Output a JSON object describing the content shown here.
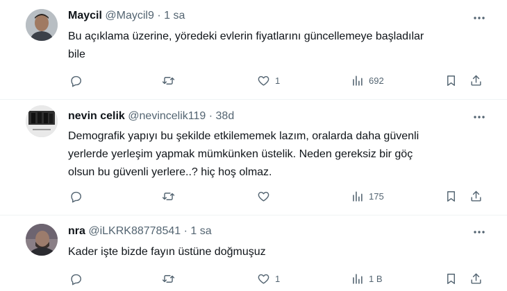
{
  "tweets": [
    {
      "name": "Maycil",
      "handle": "@Maycil9",
      "separator": "·",
      "time": "1 sa",
      "text_lines": [
        "Bu açıklama üzerine, yöredeki evlerin fiyatlarını güncellemeye başladılar",
        "bile"
      ],
      "counts": {
        "reply": "",
        "retweet": "",
        "like": "1",
        "views": "692"
      }
    },
    {
      "name": "nevin celik",
      "handle": "@nevincelik119",
      "separator": "·",
      "time": "38d",
      "text_lines": [
        "Demografik yapıyı bu şekilde etkilememek lazım, oralarda daha güvenli",
        "yerlerde yerleşim yapmak mümkünken üstelik. Neden gereksiz bir göç",
        "olsun bu güvenli yerlere..? hiç hoş olmaz."
      ],
      "counts": {
        "reply": "",
        "retweet": "",
        "like": "",
        "views": "175"
      }
    },
    {
      "name": "nra",
      "handle": "@iLKRK88778541",
      "separator": "·",
      "time": "1 sa",
      "text_lines": [
        "Kader işte bizde fayın üstüne doğmuşuz"
      ],
      "counts": {
        "reply": "",
        "retweet": "",
        "like": "1",
        "views": "1 B"
      }
    }
  ],
  "colors": {
    "text": "#0f1419",
    "secondary": "#536471",
    "border": "#eff3f4"
  },
  "icons": [
    "reply-icon",
    "retweet-icon",
    "like-icon",
    "views-icon",
    "bookmark-icon",
    "share-icon",
    "more-icon"
  ]
}
